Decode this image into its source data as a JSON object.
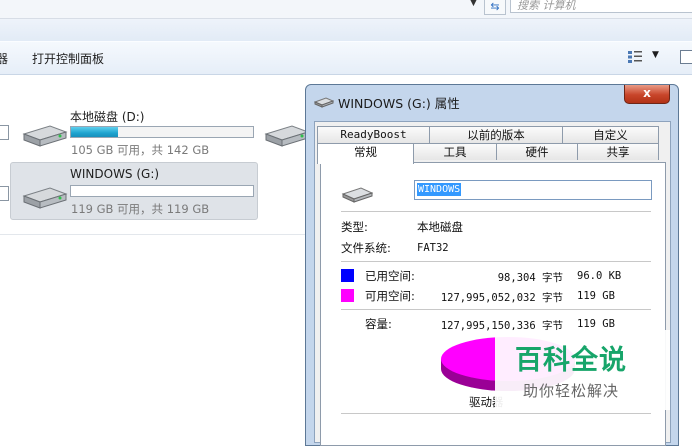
{
  "explorer": {
    "search_placeholder": "搜索 计算机",
    "toolbar": {
      "cut_label": "器",
      "control_panel": "打开控制面板"
    },
    "drives": [
      {
        "name": "本地磁盘 (D:)",
        "info": "105 GB 可用，共 142 GB",
        "used_fraction": 0.26,
        "selected": false
      },
      {
        "name": "WINDOWS (G:)",
        "info": "119 GB 可用，共 119 GB",
        "used_fraction": 0.0,
        "selected": true
      }
    ]
  },
  "dialog": {
    "title": "WINDOWS (G:) 属性",
    "close": "x",
    "tabs_row1": [
      "ReadyBoost",
      "以前的版本",
      "自定义"
    ],
    "tabs_row2": [
      "常规",
      "工具",
      "硬件",
      "共享"
    ],
    "active_tab": "常规",
    "volume_name": "WINDOWS",
    "type_label": "类型:",
    "type_value": "本地磁盘",
    "fs_label": "文件系统:",
    "fs_value": "FAT32",
    "used_label": "已用空间:",
    "used_bytes": "98,304 字节",
    "used_size": "96.0 KB",
    "free_label": "可用空间:",
    "free_bytes": "127,995,052,032 字节",
    "free_size": "119 GB",
    "cap_label": "容量:",
    "cap_bytes": "127,995,150,336 字节",
    "cap_size": "119 GB",
    "drive_caption": "驱动器",
    "colors": {
      "used": "#0000ff",
      "free": "#ff00ff"
    }
  },
  "watermark": {
    "title": "百科全说",
    "subtitle": "助你轻松解决"
  }
}
